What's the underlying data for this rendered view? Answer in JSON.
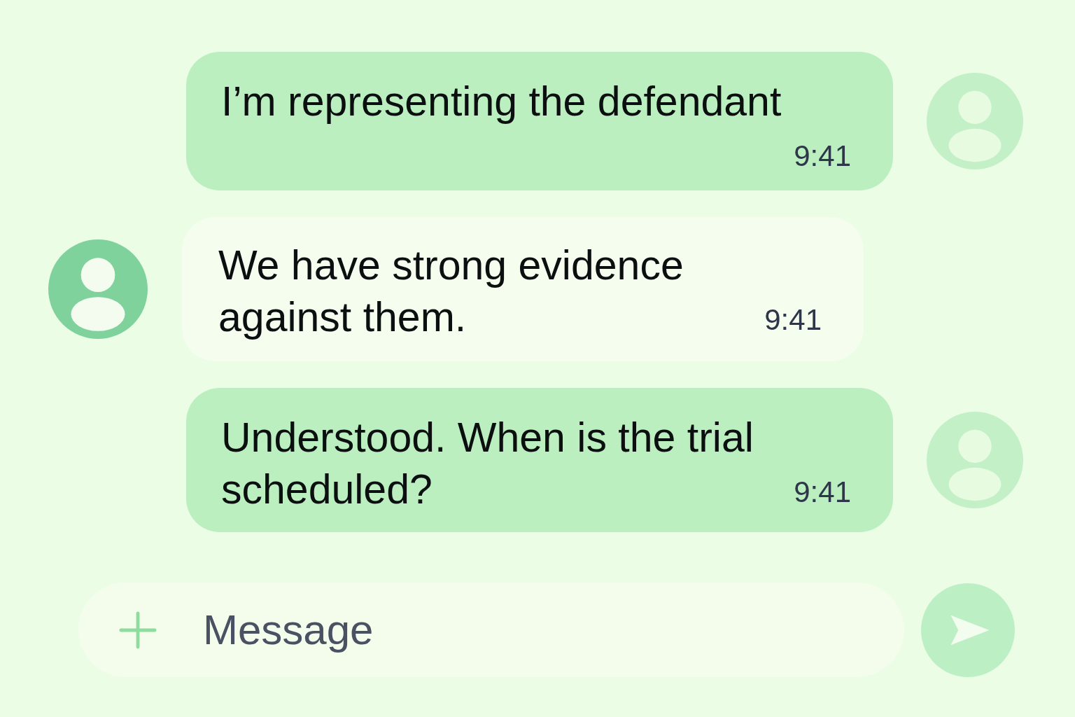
{
  "messages": [
    {
      "kind": "outgoing",
      "text": "I’m representing the defendant",
      "time": "9:41"
    },
    {
      "kind": "incoming",
      "text": "We have strong evidence against them.",
      "time": "9:41"
    },
    {
      "kind": "outgoing",
      "text": "Understood. When is the trial scheduled?",
      "time": "9:41"
    }
  ],
  "composer": {
    "placeholder": "Message"
  }
}
